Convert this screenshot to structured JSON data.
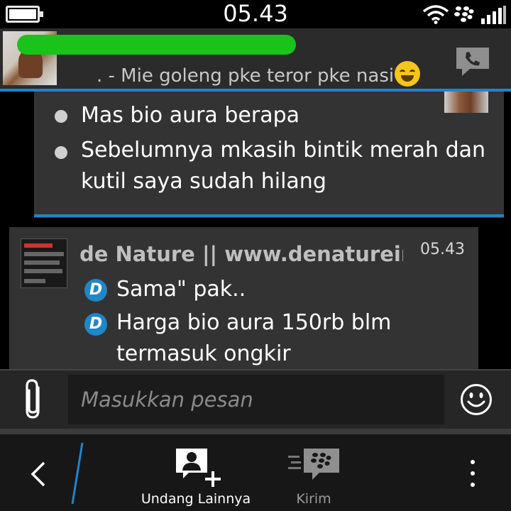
{
  "status_bar": {
    "time": "05.43",
    "icons": [
      "battery-icon",
      "wifi-icon",
      "blackberry-icon",
      "signal-icon"
    ]
  },
  "chat_header": {
    "status_message": ". - Mie goleng pke teror pke nasi",
    "icons": [
      "avatar",
      "laughing-emoji-icon",
      "voice-call-icon"
    ],
    "name_redaction_color": "#19c319"
  },
  "messages": [
    {
      "direction": "sent",
      "items": [
        "Mas bio aura berapa",
        "Sebelumnya mkasih bintik merah dan",
        "kutil saya sudah hilang"
      ]
    },
    {
      "direction": "received",
      "sender": "de Nature || www.denaturein",
      "time": "05.43",
      "badge": "D",
      "items": [
        "Sama\" pak..",
        "Harga bio aura 150rb blm",
        "termasuk ongkir"
      ]
    }
  ],
  "composer": {
    "placeholder": "Masukkan pesan",
    "icons": [
      "paperclip-icon",
      "smiley-icon"
    ]
  },
  "action_bar": {
    "invite_label": "Undang Lainnya",
    "send_label": "Kirim",
    "icons": [
      "back-icon",
      "invite-contact-icon",
      "send-bbm-icon",
      "overflow-menu-icon"
    ]
  },
  "colors": {
    "accent": "#1f86c7",
    "bubble": "#333333",
    "header": "#2b2b2b",
    "background": "#000000"
  }
}
